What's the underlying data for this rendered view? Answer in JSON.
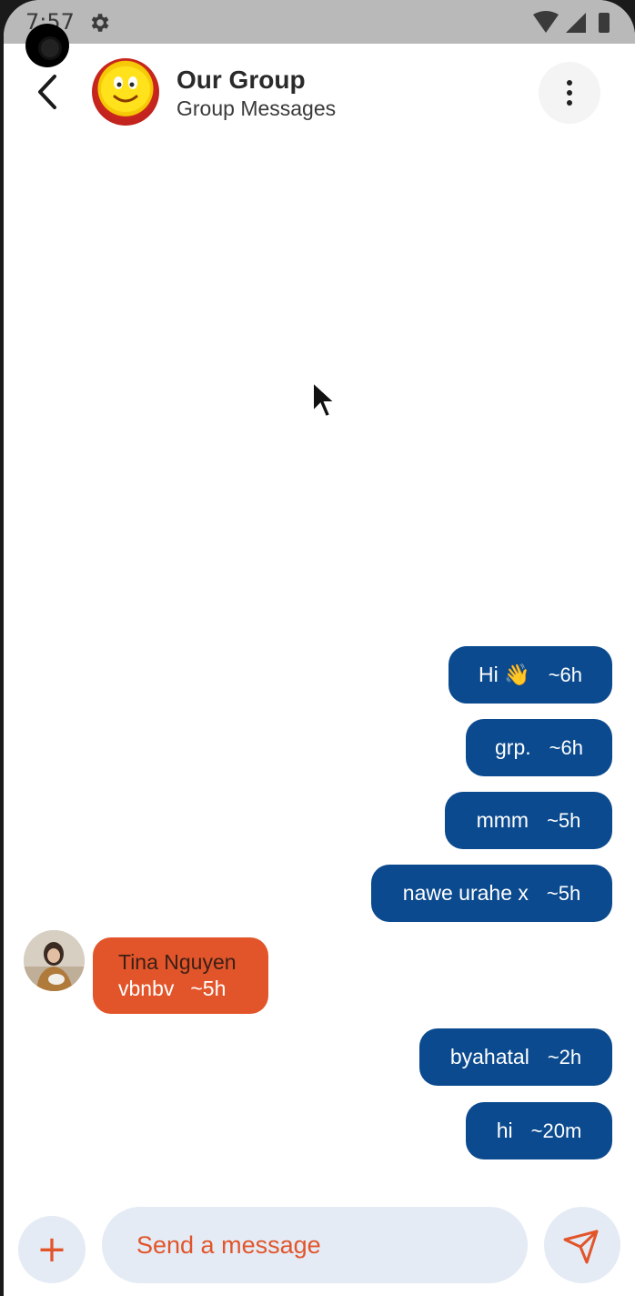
{
  "status_bar": {
    "time": "7:57"
  },
  "header": {
    "title": "Our Group",
    "subtitle": "Group Messages"
  },
  "messages": [
    {
      "direction": "outgoing",
      "text": "Hi 👋",
      "time": "~6h"
    },
    {
      "direction": "outgoing",
      "text": "grp.",
      "time": "~6h"
    },
    {
      "direction": "outgoing",
      "text": "mmm",
      "time": "~5h"
    },
    {
      "direction": "outgoing",
      "text": "nawe urahe x",
      "time": "~5h"
    },
    {
      "direction": "incoming",
      "sender": "Tina Nguyen",
      "text": "vbnbv",
      "time": "~5h"
    },
    {
      "direction": "outgoing",
      "text": "byahatal",
      "time": "~2h"
    },
    {
      "direction": "outgoing",
      "text": "hi",
      "time": "~20m"
    }
  ],
  "composer": {
    "add_label": "+",
    "placeholder": "Send a message"
  },
  "colors": {
    "outgoing_bubble": "#0b4a8e",
    "incoming_bubble": "#e2552a",
    "accent": "#e2552a",
    "input_bg": "#e4ebf5"
  }
}
